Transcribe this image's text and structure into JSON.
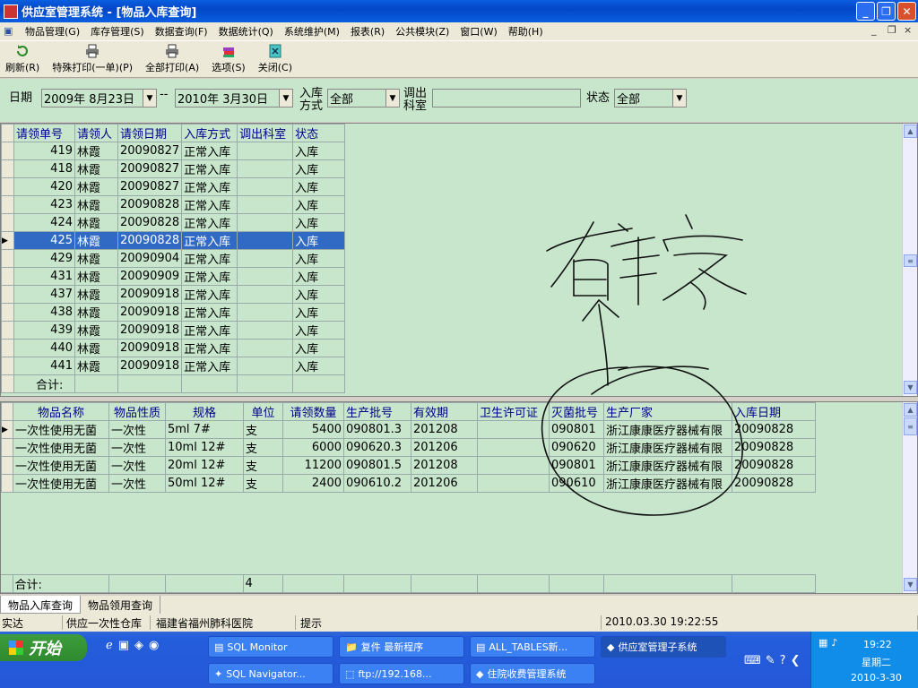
{
  "window": {
    "title": "供应室管理系统 - [物品入库查询]"
  },
  "menu": [
    "物品管理(G)",
    "库存管理(S)",
    "数据查询(F)",
    "数据统计(Q)",
    "系统维护(M)",
    "报表(R)",
    "公共模块(Z)",
    "窗口(W)",
    "帮助(H)"
  ],
  "toolbar": {
    "refresh": "刷新(R)",
    "special_print": "特殊打印(一单)(P)",
    "print_all": "全部打印(A)",
    "options": "选项(S)",
    "close": "关闭(C)"
  },
  "filter": {
    "date_label": "日期",
    "date_from": "2009年  8月23日",
    "date_sep": "--",
    "date_to": "2010年  3月30日",
    "method_label": "入库方式",
    "method_value": "全部",
    "dept_label": "调出科室",
    "dept_value": "",
    "status_label": "状态",
    "status_value": "全部"
  },
  "upper_grid": {
    "headers": [
      "请领单号",
      "请领人",
      "请领日期",
      "入库方式",
      "调出科室",
      "状态"
    ],
    "rows": [
      [
        "419",
        "林霞",
        "20090827",
        "正常入库",
        "",
        "入库"
      ],
      [
        "418",
        "林霞",
        "20090827",
        "正常入库",
        "",
        "入库"
      ],
      [
        "420",
        "林霞",
        "20090827",
        "正常入库",
        "",
        "入库"
      ],
      [
        "423",
        "林霞",
        "20090828",
        "正常入库",
        "",
        "入库"
      ],
      [
        "424",
        "林霞",
        "20090828",
        "正常入库",
        "",
        "入库"
      ],
      [
        "425",
        "林霞",
        "20090828",
        "正常入库",
        "",
        "入库"
      ],
      [
        "429",
        "林霞",
        "20090904",
        "正常入库",
        "",
        "入库"
      ],
      [
        "431",
        "林霞",
        "20090909",
        "正常入库",
        "",
        "入库"
      ],
      [
        "437",
        "林霞",
        "20090918",
        "正常入库",
        "",
        "入库"
      ],
      [
        "438",
        "林霞",
        "20090918",
        "正常入库",
        "",
        "入库"
      ],
      [
        "439",
        "林霞",
        "20090918",
        "正常入库",
        "",
        "入库"
      ],
      [
        "440",
        "林霞",
        "20090918",
        "正常入库",
        "",
        "入库"
      ],
      [
        "441",
        "林霞",
        "20090918",
        "正常入库",
        "",
        "入库"
      ]
    ],
    "selected_row": 5,
    "total_label": "合计:"
  },
  "lower_grid": {
    "headers": [
      "物品名称",
      "物品性质",
      "规格",
      "单位",
      "请领数量",
      "生产批号",
      "有效期",
      "卫生许可证",
      "灭菌批号",
      "生产厂家",
      "入库日期"
    ],
    "rows": [
      [
        "一次性使用无菌",
        "一次性",
        "5ml    7#",
        "支",
        "5400",
        "090801.3",
        "201208",
        "",
        "090801",
        "浙江康康医疗器械有限",
        "20090828"
      ],
      [
        "一次性使用无菌",
        "一次性",
        "10ml   12#",
        "支",
        "6000",
        "090620.3",
        "201206",
        "",
        "090620",
        "浙江康康医疗器械有限",
        "20090828"
      ],
      [
        "一次性使用无菌",
        "一次性",
        "20ml   12#",
        "支",
        "11200",
        "090801.5",
        "201208",
        "",
        "090801",
        "浙江康康医疗器械有限",
        "20090828"
      ],
      [
        "一次性使用无菌",
        "一次性",
        "50ml 12#",
        "支",
        "2400",
        "090610.2",
        "201206",
        "",
        "090610",
        "浙江康康医疗器械有限",
        "20090828"
      ]
    ],
    "total_label": "合计:",
    "total_unit_count": "4"
  },
  "annotation_text": "有厂家",
  "tabs": [
    "物品入库查询",
    "物品领用查询"
  ],
  "status": {
    "user": "实达",
    "store": "供应一次性仓库",
    "hospital": "福建省福州肺科医院",
    "hint": "提示",
    "datetime": "2010.03.30 19:22:55"
  },
  "taskbar": {
    "start": "开始",
    "tasks": [
      "SQL Monitor",
      "复件 最新程序",
      "ALL_TABLES新...",
      "供应室管理子系统",
      "SQL Navigator...",
      "ftp://192.168...",
      "住院收费管理系统"
    ],
    "clock_time": "19:22",
    "clock_day": "星期二",
    "clock_date": "2010-3-30"
  }
}
